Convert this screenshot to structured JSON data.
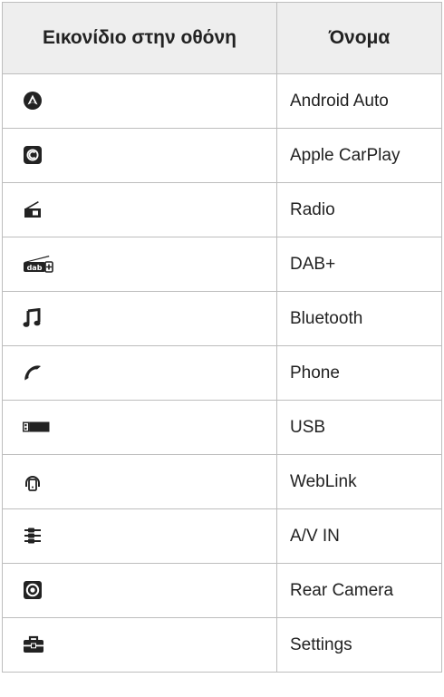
{
  "table": {
    "headers": {
      "icon": "Εικονίδιο στην οθόνη",
      "name": "Όνομα"
    },
    "rows": [
      {
        "icon": "android-auto-icon",
        "name": "Android Auto"
      },
      {
        "icon": "apple-carplay-icon",
        "name": "Apple CarPlay"
      },
      {
        "icon": "radio-icon",
        "name": "Radio"
      },
      {
        "icon": "dab-plus-icon",
        "name": "DAB+"
      },
      {
        "icon": "bluetooth-music-icon",
        "name": "Bluetooth"
      },
      {
        "icon": "phone-icon",
        "name": "Phone"
      },
      {
        "icon": "usb-icon",
        "name": "USB"
      },
      {
        "icon": "weblink-icon",
        "name": "WebLink"
      },
      {
        "icon": "av-in-icon",
        "name": "A/V IN"
      },
      {
        "icon": "rear-camera-icon",
        "name": "Rear Camera"
      },
      {
        "icon": "settings-toolbox-icon",
        "name": "Settings"
      }
    ]
  },
  "colors": {
    "header_bg": "#eeeeee",
    "border": "#bdbdbd",
    "icon": "#222222"
  }
}
